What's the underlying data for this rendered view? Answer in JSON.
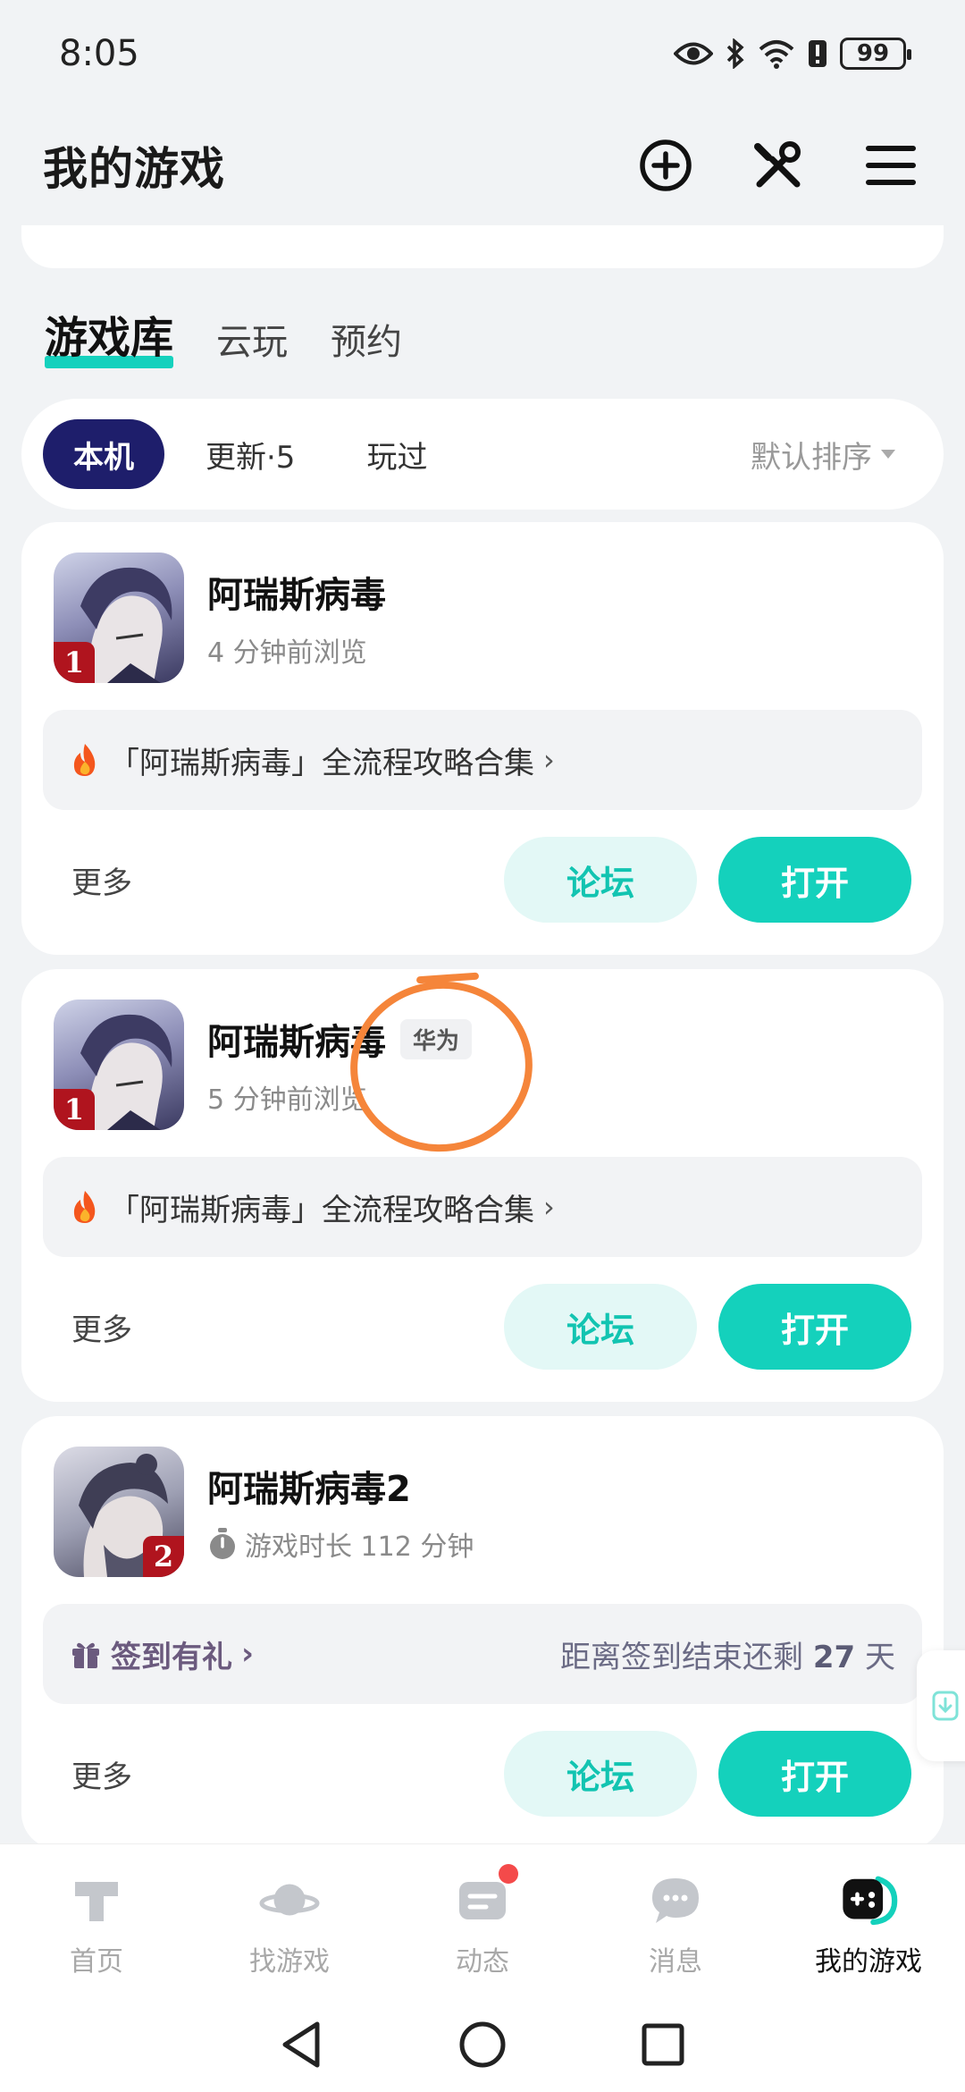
{
  "status": {
    "time": "8:05",
    "battery": "99"
  },
  "header": {
    "title": "我的游戏"
  },
  "tabs": [
    {
      "label": "游戏库"
    },
    {
      "label": "云玩"
    },
    {
      "label": "预约"
    }
  ],
  "filters": {
    "chips": [
      "本机",
      "更新·5",
      "玩过"
    ],
    "sort": "默认排序"
  },
  "cards": [
    {
      "name": "阿瑞斯病毒",
      "subtitle": "4 分钟前浏览",
      "badge": "1",
      "guide": "「阿瑞斯病毒」全流程攻略合集",
      "more": "更多",
      "forum": "论坛",
      "open": "打开"
    },
    {
      "name": "阿瑞斯病毒",
      "tag": "华为",
      "subtitle": "5 分钟前浏览",
      "badge": "1",
      "guide": "「阿瑞斯病毒」全流程攻略合集",
      "more": "更多",
      "forum": "论坛",
      "open": "打开"
    },
    {
      "name": "阿瑞斯病毒2",
      "subtitle": "游戏时长 112 分钟",
      "badge": "2",
      "checkin_label": "签到有礼",
      "checkin_remaining_prefix": "距离签到结束还剩",
      "checkin_days": "27",
      "checkin_suffix": "天",
      "more": "更多",
      "forum": "论坛",
      "open": "打开"
    }
  ],
  "bottom_nav": [
    {
      "label": "首页"
    },
    {
      "label": "找游戏"
    },
    {
      "label": "动态"
    },
    {
      "label": "消息"
    },
    {
      "label": "我的游戏"
    }
  ],
  "colors": {
    "accent": "#14d1bc",
    "chip_active": "#1e1e6b",
    "annotation": "#f5853a"
  }
}
